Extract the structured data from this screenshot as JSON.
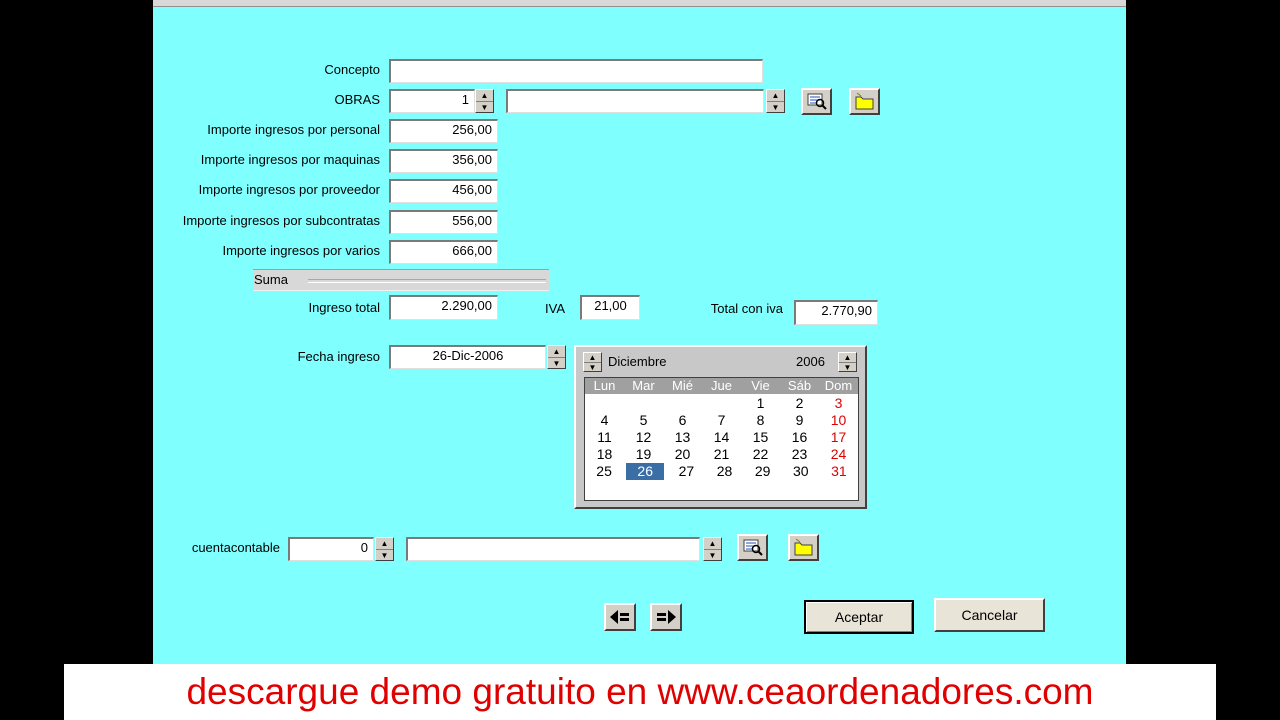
{
  "form": {
    "concepto": {
      "label": "Concepto",
      "value": ""
    },
    "obras": {
      "label": "OBRAS",
      "value": "1",
      "description": ""
    },
    "rows": [
      {
        "label": "Importe ingresos por personal",
        "value": "256,00"
      },
      {
        "label": "Importe ingresos por maquinas",
        "value": "356,00"
      },
      {
        "label": "Importe ingresos por proveedor",
        "value": "456,00"
      },
      {
        "label": "Importe ingresos por subcontratas",
        "value": "556,00"
      },
      {
        "label": "Importe ingresos por varios",
        "value": "666,00"
      }
    ],
    "suma_label": "Suma",
    "ingreso_total": {
      "label": "Ingreso total",
      "value": "2.290,00"
    },
    "iva": {
      "label": "IVA",
      "value": "21,00"
    },
    "total_con_iva": {
      "label": "Total con iva",
      "value": "2.770,90"
    },
    "fecha_ingreso": {
      "label": "Fecha ingreso",
      "value": "26-Dic-2006"
    },
    "cuentacontable": {
      "label": "cuentacontable",
      "value": "0",
      "description": ""
    }
  },
  "calendar": {
    "month": "Diciembre",
    "year": "2006",
    "weekdays": [
      "Lun",
      "Mar",
      "Mié",
      "Jue",
      "Vie",
      "Sáb",
      "Dom"
    ],
    "weeks": [
      [
        "",
        "",
        "",
        "",
        "1",
        "2",
        "3"
      ],
      [
        "4",
        "5",
        "6",
        "7",
        "8",
        "9",
        "10"
      ],
      [
        "11",
        "12",
        "13",
        "14",
        "15",
        "16",
        "17"
      ],
      [
        "18",
        "19",
        "20",
        "21",
        "22",
        "23",
        "24"
      ],
      [
        "25",
        "26",
        "27",
        "28",
        "29",
        "30",
        "31"
      ]
    ],
    "selected_day": "26",
    "weekend_color": "#e00000",
    "selection_color": "#3a6ea5"
  },
  "buttons": {
    "aceptar": "Aceptar",
    "cancelar": "Cancelar"
  },
  "icons": {
    "search": "search-icon",
    "new": "new-folder-icon",
    "prev": "prev-record-icon",
    "next": "next-record-icon"
  },
  "banner": {
    "text": "descargue demo gratuito en www.ceaordenadores.com"
  },
  "colors": {
    "form_background": "#80ffff",
    "banner_text": "#e00000"
  }
}
